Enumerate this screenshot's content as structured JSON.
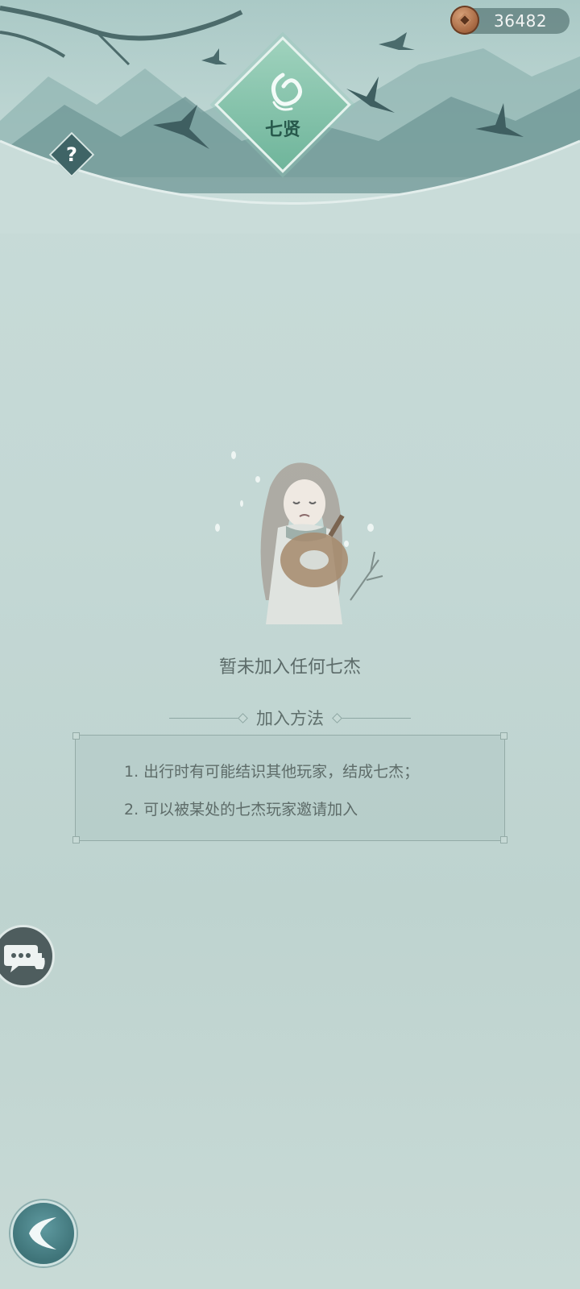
{
  "currency": {
    "icon": "copper-coin-icon",
    "value": "36482"
  },
  "help": {
    "symbol": "?"
  },
  "emblem": {
    "title": "七贤"
  },
  "empty_state": {
    "message": "暂未加入任何七杰"
  },
  "join_method": {
    "heading": "加入方法",
    "rules": [
      "1. 出行时有可能结识其他玩家，结成七杰；",
      "2. 可以被某处的七杰玩家邀请加入"
    ]
  },
  "colors": {
    "background": "#c6d9d5",
    "text": "#5e6c69",
    "accent": "#6fb59b"
  }
}
